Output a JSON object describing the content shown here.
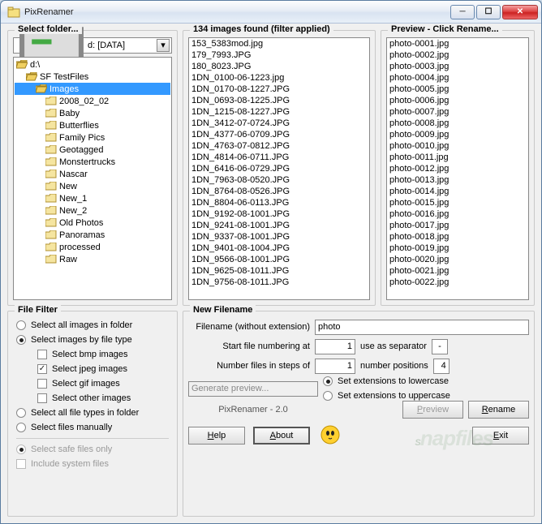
{
  "window": {
    "title": "PixRenamer"
  },
  "folder": {
    "legend": "Select folder...",
    "drive": "d: [DATA]",
    "items": [
      {
        "label": "d:\\",
        "depth": 0,
        "open": true
      },
      {
        "label": "SF TestFiles",
        "depth": 1,
        "open": true
      },
      {
        "label": "Images",
        "depth": 2,
        "open": true,
        "selected": true
      },
      {
        "label": "2008_02_02",
        "depth": 3,
        "open": false
      },
      {
        "label": "Baby",
        "depth": 3,
        "open": false
      },
      {
        "label": "Butterflies",
        "depth": 3,
        "open": false
      },
      {
        "label": "Family Pics",
        "depth": 3,
        "open": false
      },
      {
        "label": "Geotagged",
        "depth": 3,
        "open": false
      },
      {
        "label": "Monstertrucks",
        "depth": 3,
        "open": false
      },
      {
        "label": "Nascar",
        "depth": 3,
        "open": false
      },
      {
        "label": "New",
        "depth": 3,
        "open": false
      },
      {
        "label": "New_1",
        "depth": 3,
        "open": false
      },
      {
        "label": "New_2",
        "depth": 3,
        "open": false
      },
      {
        "label": "Old Photos",
        "depth": 3,
        "open": false
      },
      {
        "label": "Panoramas",
        "depth": 3,
        "open": false
      },
      {
        "label": "processed",
        "depth": 3,
        "open": false
      },
      {
        "label": "Raw",
        "depth": 3,
        "open": false
      }
    ]
  },
  "images": {
    "legend": "134 images found (filter applied)",
    "files": [
      "153_5383mod.jpg",
      "179_7993.JPG",
      "180_8023.JPG",
      "1DN_0100-06-1223.jpg",
      "1DN_0170-08-1227.JPG",
      "1DN_0693-08-1225.JPG",
      "1DN_1215-08-1227.JPG",
      "1DN_3412-07-0724.JPG",
      "1DN_4377-06-0709.JPG",
      "1DN_4763-07-0812.JPG",
      "1DN_4814-06-0711.JPG",
      "1DN_6416-06-0729.JPG",
      "1DN_7963-08-0520.JPG",
      "1DN_8764-08-0526.JPG",
      "1DN_8804-06-0113.JPG",
      "1DN_9192-08-1001.JPG",
      "1DN_9241-08-1001.JPG",
      "1DN_9337-08-1001.JPG",
      "1DN_9401-08-1004.JPG",
      "1DN_9566-08-1001.JPG",
      "1DN_9625-08-1011.JPG",
      "1DN_9756-08-1011.JPG"
    ]
  },
  "preview": {
    "legend": "Preview - Click Rename...",
    "files": [
      "photo-0001.jpg",
      "photo-0002.jpg",
      "photo-0003.jpg",
      "photo-0004.jpg",
      "photo-0005.jpg",
      "photo-0006.jpg",
      "photo-0007.jpg",
      "photo-0008.jpg",
      "photo-0009.jpg",
      "photo-0010.jpg",
      "photo-0011.jpg",
      "photo-0012.jpg",
      "photo-0013.jpg",
      "photo-0014.jpg",
      "photo-0015.jpg",
      "photo-0016.jpg",
      "photo-0017.jpg",
      "photo-0018.jpg",
      "photo-0019.jpg",
      "photo-0020.jpg",
      "photo-0021.jpg",
      "photo-0022.jpg"
    ]
  },
  "filter": {
    "legend": "File Filter",
    "opt_all_images": "Select all images in folder",
    "opt_by_type": "Select images by file type",
    "chk_bmp": "Select bmp images",
    "chk_jpeg": "Select jpeg images",
    "chk_gif": "Select gif images",
    "chk_other": "Select other images",
    "opt_all_files": "Select all file types in folder",
    "opt_manual": "Select files manually",
    "opt_safe": "Select safe files only",
    "chk_system": "Include system files"
  },
  "newname": {
    "legend": "New Filename",
    "lbl_filename": "Filename (without extension)",
    "val_filename": "photo",
    "lbl_start": "Start file numbering at",
    "val_start": "1",
    "lbl_sep": "use as separator",
    "val_sep": "-",
    "lbl_step": "Number files in steps of",
    "val_step": "1",
    "lbl_positions": "number positions",
    "val_positions": "4",
    "generate": "Generate preview...",
    "opt_lower": "Set extensions to lowercase",
    "opt_upper": "Set extensions to uppercase",
    "brand": "PixRenamer - 2.0",
    "btn_preview": "Preview",
    "btn_rename": "Rename",
    "btn_help": "Help",
    "btn_about": "About",
    "btn_exit": "Exit"
  },
  "watermark": "Snapfiles"
}
